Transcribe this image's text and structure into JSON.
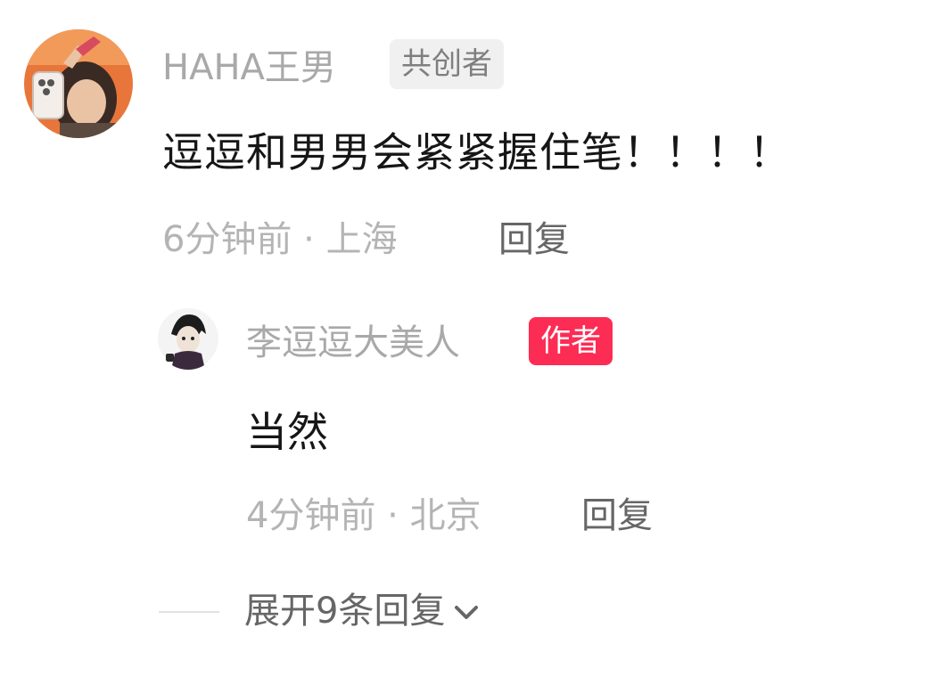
{
  "comment": {
    "username": "HAHA王男",
    "badge": "共创者",
    "text": "逗逗和男男会紧紧握住笔！！！！",
    "meta": "6分钟前 · 上海",
    "reply_label": "回复",
    "avatar_icon": "user-avatar-photo"
  },
  "reply": {
    "username": "李逗逗大美人",
    "badge": "作者",
    "text": "当然",
    "meta": "4分钟前 · 北京",
    "reply_label": "回复",
    "avatar_icon": "anime-character-avatar"
  },
  "expand": {
    "label": "展开9条回复",
    "icon": "chevron-down-icon"
  },
  "colors": {
    "author_badge": "#fd2c55",
    "cocreator_badge_bg": "#f0f0f0",
    "muted_text": "#b4b4b4",
    "body_text": "#161616"
  }
}
